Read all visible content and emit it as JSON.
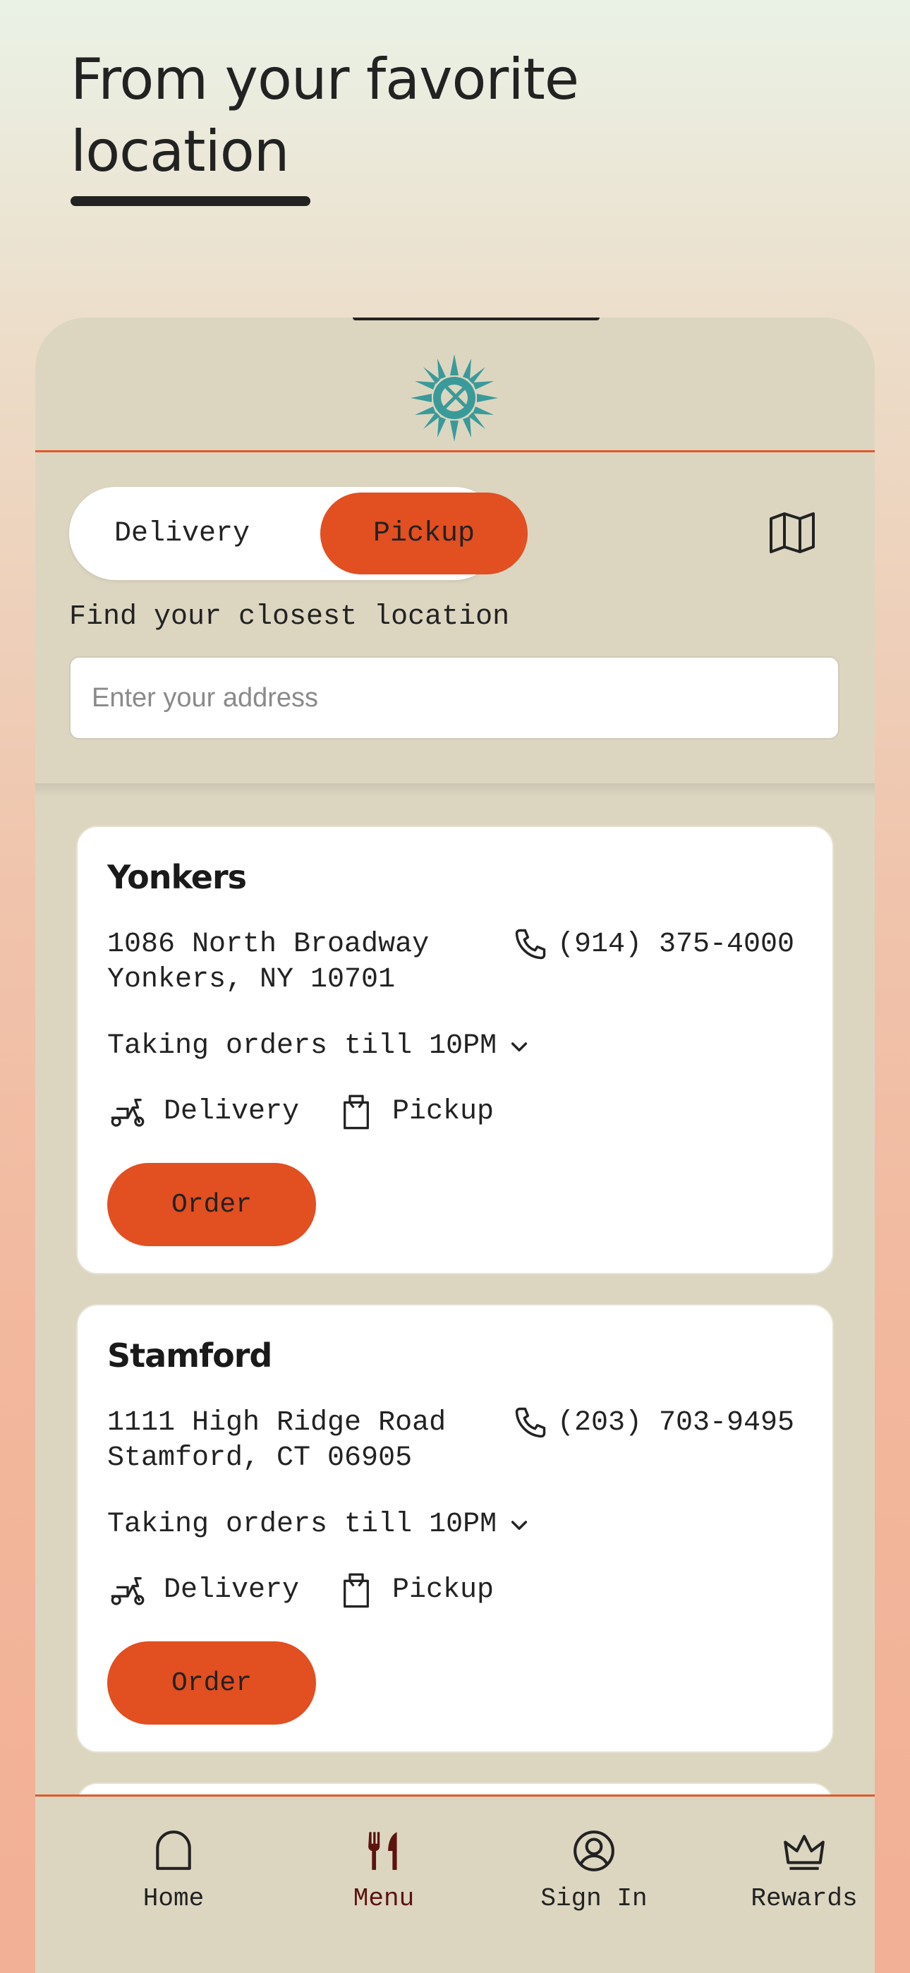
{
  "hero": {
    "title": "From your favorite location"
  },
  "order_mode": {
    "delivery_label": "Delivery",
    "pickup_label": "Pickup",
    "selected": "Pickup"
  },
  "finder": {
    "label": "Find your closest location",
    "address_placeholder": "Enter your address",
    "address_value": ""
  },
  "locations": [
    {
      "name": "Yonkers",
      "address_line1": "1086 North Broadway",
      "address_line2": "Yonkers, NY 10701",
      "phone": "(914) 375-4000",
      "hours": "Taking orders till 10PM",
      "services": {
        "delivery": "Delivery",
        "pickup": "Pickup"
      },
      "order_label": "Order"
    },
    {
      "name": "Stamford",
      "address_line1": "1111 High Ridge Road",
      "address_line2": "Stamford, CT 06905",
      "phone": "(203) 703-9495",
      "hours": "Taking orders till 10PM",
      "services": {
        "delivery": "Delivery",
        "pickup": "Pickup"
      },
      "order_label": "Order"
    }
  ],
  "nav": [
    {
      "label": "Home",
      "icon": "home-icon",
      "active": false
    },
    {
      "label": "Menu",
      "icon": "fork-knife-icon",
      "active": true
    },
    {
      "label": "Sign In",
      "icon": "user-circle-icon",
      "active": false
    },
    {
      "label": "Rewards",
      "icon": "crown-icon",
      "active": false
    }
  ],
  "colors": {
    "accent": "#e24f21",
    "panel": "#dcd6c1",
    "logo": "#3a9a9a",
    "nav_active": "#5c1410"
  }
}
